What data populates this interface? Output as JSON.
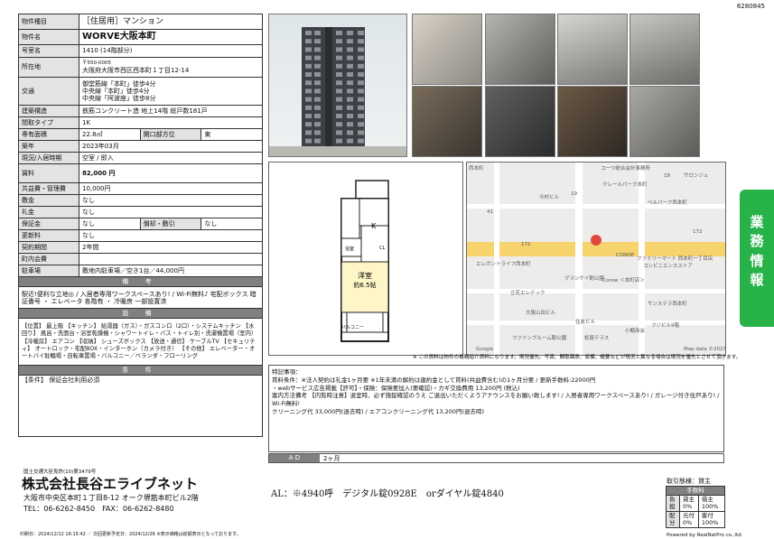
{
  "doc_id": "6280845",
  "props": [
    {
      "label": "物件種目",
      "value": "［住居用］マンション"
    },
    {
      "label": "物件名",
      "value": "WORVE大阪本町"
    },
    {
      "label": "号室名",
      "value": "1410 (14階部分)"
    },
    {
      "label": "所在地",
      "value_zip": "〒550-0005",
      "value": "大阪府大阪市西区西本町１丁目12-14"
    },
    {
      "label": "交通",
      "lines": [
        "御堂筋線「本町」徒歩4分",
        "中央線「本町」徒歩4分",
        "中央線「阿波座」徒歩8分"
      ]
    },
    {
      "label": "建築構造",
      "value": "鉄筋コンクリート造 地上14階 総戸数181戸"
    },
    {
      "label": "間取タイプ",
      "value": "1K"
    },
    {
      "label": "専有面積",
      "value": "22.8㎡",
      "label2": "開口部方位",
      "value2": "東"
    },
    {
      "label": "築年",
      "value": "2023年03月"
    },
    {
      "label": "現況/入居時期",
      "value": "空室 / 即入"
    },
    {
      "label": "賃料",
      "value": "82,000 円"
    },
    {
      "label": "共益費・管理費",
      "value": "10,000円"
    },
    {
      "label": "敷金",
      "value": "なし"
    },
    {
      "label": "礼金",
      "value": "なし"
    },
    {
      "label": "保証金",
      "value": "なし",
      "label2": "償却・敷引",
      "value2": "なし"
    },
    {
      "label": "更新料",
      "value": "なし"
    },
    {
      "label": "契約期間",
      "value": "2年間"
    },
    {
      "label": "町内会費",
      "value": ""
    },
    {
      "label": "駐車場",
      "value": "敷地内駐車場／空き1台／44,000円"
    }
  ],
  "remarks_title": "備 考",
  "remarks": "駅近!便利な立地◎ / 入居者専用ワークスペースあり! / Wi-Fi無料♪ 宅配ボックス 暗証番号 ・ エレベータ 各階有 ・ 冷暖房 一部設置済",
  "equip_title": "設 備",
  "equipment": "【位置】 最上階 【キッチン】 給湯器（ガス）・ガスコンロ（2口）・システムキッチン 【水回り】 風呂・洗面台・浴室乾燥機・シャワートイレ・バス・トイレ別・洗濯機置場（室内） 【冷暖房】 エアコン 【収納】 シューズボックス 【放送・通信】 ケーブルTV 【セキュリティ】 オートロック・宅配BOX・インターホン（カメラ付き） 【その他】 エレベーター・オートバイ駐輪場・自転車置場・バルコニー／ベランダ・フローリング",
  "cond_title": "条 件",
  "conditions": "【条件】 保証会社利用必須",
  "floorplan": {
    "room": "洋室",
    "size": "約6.5帖",
    "kitchen": "K",
    "balcony": "バルコニー",
    "bath": "浴室",
    "cl": "CL"
  },
  "map": {
    "labels": [
      "西本町",
      "コーワ総合会計事務所",
      "18",
      "サロンジェ",
      "クレールパーク本町",
      "19",
      "今村ビル",
      "ベルパーク西本町",
      "172",
      "172",
      "41",
      "ファミリーマート 西本町一丁目店",
      "コンビニエンスストア",
      "エレガントライフ西本町",
      "CONOE",
      "Conoe ＜本町店＞",
      "グランケイ靭公園",
      "立花エレテック",
      "サンステラ西本町",
      "大阪山田ビル",
      "住友ビル",
      "フジビル9階",
      "ファインブルーム靭公園",
      "松尾テラス",
      "小鯖商会",
      "Google",
      "Map data ©2023"
    ]
  },
  "notes_caption": "※ この資料は物件の概略紹介資料になります。現況優先。写真、間取図表、設備、概要などが現況と異なる場合は現況を優先とさせて頂きます。",
  "notes_title": "特記事項：",
  "notes": [
    "賃料条件：※法人契約は礼金1ヶ月要 ※1年未満の解約は違約金として賃料(共益費含む)の1ヶ月分要 / 更新手数料:22000円",
    "・webサービス広告掲載【許可】・保険：保険要加入(要確認)・カギ交換費用 13,200円 (税込)",
    "案内方法備考 【内覧時注意】退室時、必ず施錠確認のうえ ご退出いただくようアナウンスをお願い致します! / 入居者専用ワークスペースあり! / ガレージ付き住戸あり! / Wi-Fi無料!",
    "クリーニング代 33,000円(退去時) / エアコンクリーニング代 13,200円(退去時)"
  ],
  "ad": {
    "label": "A D",
    "value": "2ヶ月"
  },
  "side_tab": [
    "業",
    "務",
    "情",
    "報"
  ],
  "company": {
    "license": "国土交通大臣免許(10)第3479号",
    "name": "株式会社長谷エライブネット",
    "address": "大阪市中央区本町１丁目8-12 オーク堺筋本町ビル2階",
    "tel": "TEL：06-6262-8450　FAX：06-6262-8480",
    "al": "AL：※4940呼　デジタル錠0928E　orダイヤル錠4840"
  },
  "torihiki": {
    "title": "取引態様：貸主",
    "fee_title": "手数料",
    "rows": [
      [
        "負担",
        "貸主 0%",
        "借主 100%"
      ],
      [
        "配分",
        "元付 0%",
        "客付 100%"
      ]
    ]
  },
  "dates": "印刷日：2024/12/12 16:15:42 ／ 次回更新予定日：2024/12/26 ※表示価格は総額表示となっております。",
  "powered": "Powered by RealNetPro co.,ltd."
}
